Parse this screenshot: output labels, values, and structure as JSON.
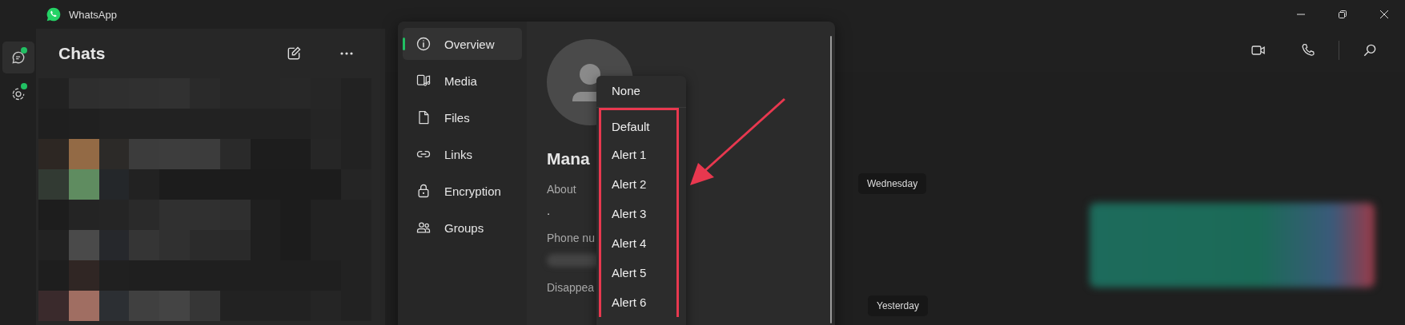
{
  "window": {
    "title": "WhatsApp"
  },
  "rail": [
    {
      "kind": "chats",
      "selected": true,
      "unread": true
    },
    {
      "kind": "status",
      "selected": false,
      "unread": true
    }
  ],
  "chat_list": {
    "title": "Chats"
  },
  "info_panel": {
    "nav": [
      {
        "kind": "info",
        "label": "Overview",
        "selected": true
      },
      {
        "kind": "media",
        "label": "Media",
        "selected": false
      },
      {
        "kind": "file",
        "label": "Files",
        "selected": false
      },
      {
        "kind": "link",
        "label": "Links",
        "selected": false
      },
      {
        "kind": "lock",
        "label": "Encryption",
        "selected": false
      },
      {
        "kind": "people",
        "label": "Groups",
        "selected": false
      }
    ],
    "name": "Mana",
    "fields": [
      {
        "kind": "text",
        "label": "About",
        "value": "."
      },
      {
        "kind": "blurred",
        "label": "Phone nu"
      },
      {
        "kind": "label",
        "label": "Disappea"
      }
    ]
  },
  "sound_menu": {
    "items": [
      {
        "label": "None",
        "highlighted": false
      },
      {
        "label": "Default",
        "highlighted": true
      },
      {
        "label": "Alert 1",
        "highlighted": true
      },
      {
        "label": "Alert 2",
        "highlighted": true
      },
      {
        "label": "Alert 3",
        "highlighted": true
      },
      {
        "label": "Alert 4",
        "highlighted": true
      },
      {
        "label": "Alert 5",
        "highlighted": true
      },
      {
        "label": "Alert 6",
        "highlighted": true
      }
    ],
    "arrow": true
  },
  "chat": {
    "date_chips": [
      "Wednesday",
      "Yesterday"
    ]
  }
}
